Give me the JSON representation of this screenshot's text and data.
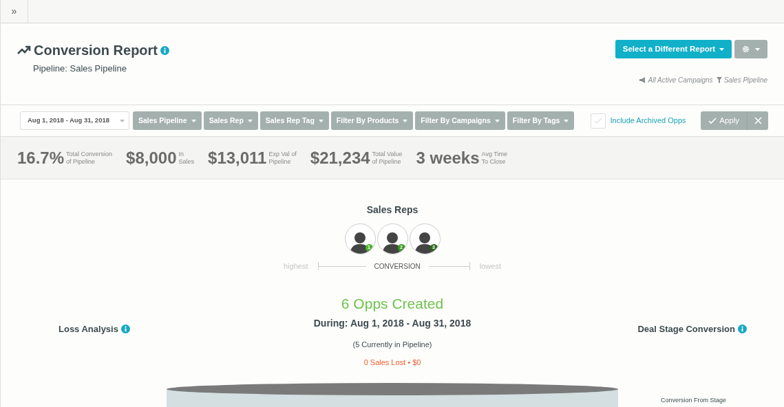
{
  "topbar": {
    "expand_glyph": "»"
  },
  "header": {
    "title": "Conversion Report",
    "subtitle": "Pipeline: Sales Pipeline",
    "report_button": "Select a Different Report",
    "campaign_filter": "All Active Campaigns",
    "pipeline_filter": "Sales Pipeline"
  },
  "filters": {
    "date_range": "Aug 1, 2018 - Aug 31, 2018",
    "dropdowns": [
      "Sales Pipeline",
      "Sales Rep",
      "Sales Rep Tag",
      "Filter By Products",
      "Filter By Campaigns",
      "Filter By Tags"
    ],
    "include_archived": {
      "label": "Include Archived Opps",
      "checked": false
    },
    "apply": "Apply"
  },
  "stats": [
    {
      "value": "16.7%",
      "label_1": "Total Conversion",
      "label_2": "of Pipeline"
    },
    {
      "value": "$8,000",
      "label_1": "In",
      "label_2": "Sales"
    },
    {
      "value": "$13,011",
      "label_1": "Exp Val of",
      "label_2": "Pipeline"
    },
    {
      "value": "$21,234",
      "label_1": "Total Value",
      "label_2": "of Pipeline"
    },
    {
      "value": "3 weeks",
      "label_1": "Avg Time",
      "label_2": "To Close"
    }
  ],
  "sales_reps": {
    "title": "Sales Reps",
    "reps": [
      {
        "rank": "1",
        "color": "#4cb52a"
      },
      {
        "rank": "2",
        "color": "#3a9a22"
      },
      {
        "rank": "3",
        "color": "#2a6a1a"
      }
    ],
    "scale_high": "highest",
    "scale_label": "CONVERSION",
    "scale_low": "lowest"
  },
  "loss_analysis": {
    "title": "Loss Analysis"
  },
  "summary": {
    "headline": "6 Opps Created",
    "period": "During: Aug 1, 2018 - Aug 31, 2018",
    "in_pipeline": "(5 Currently in Pipeline)",
    "lost": "0 Sales Lost • $0"
  },
  "deal_stage": {
    "title": "Deal Stage Conversion",
    "subtitle": "Conversion From Stage"
  }
}
